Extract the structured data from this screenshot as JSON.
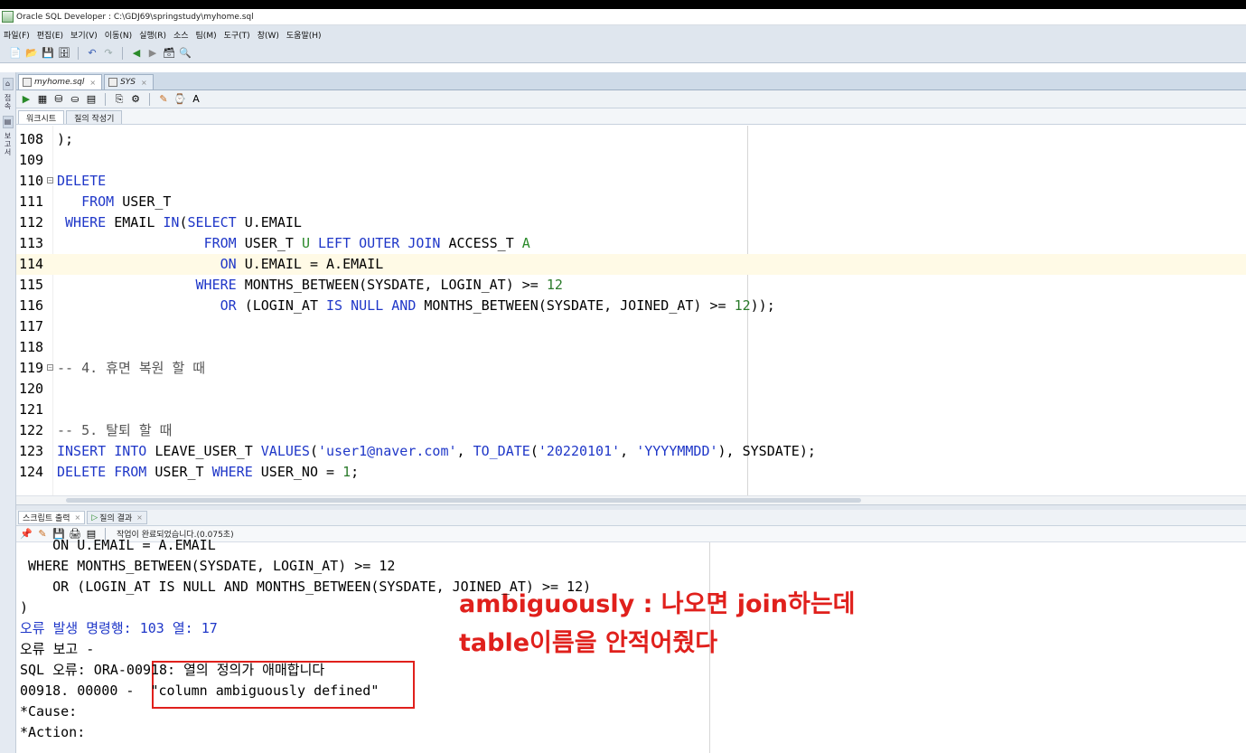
{
  "window": {
    "title": "Oracle SQL Developer : C:\\GDJ69\\springstudy\\myhome.sql"
  },
  "menu": [
    "파일(F)",
    "편집(E)",
    "보기(V)",
    "이동(N)",
    "실행(R)",
    "소스",
    "팀(M)",
    "도구(T)",
    "창(W)",
    "도움말(H)"
  ],
  "file_tabs": [
    {
      "label": "myhome.sql",
      "active": true
    },
    {
      "label": "SYS",
      "active": false
    }
  ],
  "sub_tabs": [
    {
      "label": "워크시트",
      "active": true
    },
    {
      "label": "질의 작성기",
      "active": false
    }
  ],
  "left_rail": {
    "label_top": "접속",
    "label_mid": "보고서"
  },
  "editor": {
    "current_line_index": 6,
    "lines": [
      {
        "num": "108",
        "html": ");"
      },
      {
        "num": "109",
        "html": ""
      },
      {
        "num": "110",
        "html": "<span class='kw'>DELETE</span>",
        "fold": true
      },
      {
        "num": "111",
        "html": "   <span class='kw'>FROM</span> USER_T"
      },
      {
        "num": "112",
        "html": " <span class='kw'>WHERE</span> EMAIL <span class='kw'>IN</span>(<span class='kw'>SELECT</span> U.EMAIL"
      },
      {
        "num": "113",
        "html": "                  <span class='kw'>FROM</span> USER_T <span class='alias'>U</span> <span class='kw'>LEFT OUTER JOIN</span> ACCESS_T <span class='alias'>A</span>"
      },
      {
        "num": "114",
        "html": "                    <span class='kw'>ON</span> U.EMAIL = A.EMAIL"
      },
      {
        "num": "115",
        "html": "                 <span class='kw'>WHERE</span> MONTHS_BETWEEN(SYSDATE, LOGIN_AT) &gt;= <span class='num'>12</span>"
      },
      {
        "num": "116",
        "html": "                    <span class='kw'>OR</span> (LOGIN_AT <span class='kw'>IS NULL AND</span> MONTHS_BETWEEN(SYSDATE, JOINED_AT) &gt;= <span class='num'>12</span>));"
      },
      {
        "num": "117",
        "html": ""
      },
      {
        "num": "118",
        "html": ""
      },
      {
        "num": "119",
        "html": "<span class='cmt'>-- 4. 휴면 복원 할 때</span>",
        "fold": true
      },
      {
        "num": "120",
        "html": ""
      },
      {
        "num": "121",
        "html": ""
      },
      {
        "num": "122",
        "html": "<span class='cmt'>-- 5. 탈퇴 할 때</span>"
      },
      {
        "num": "123",
        "html": "<span class='kw'>INSERT INTO</span> LEAVE_USER_T <span class='kw'>VALUES</span>(<span class='str'>'user1@naver.com'</span>, <span class='kw'>TO_DATE</span>(<span class='str'>'20220101'</span>, <span class='str'>'YYYYMMDD'</span>), SYSDATE);"
      },
      {
        "num": "124",
        "html": "<span class='kw'>DELETE FROM</span> USER_T <span class='kw'>WHERE</span> USER_NO = <span class='num'>1</span>;"
      }
    ]
  },
  "output_tabs": [
    {
      "label": "스크립트 출력",
      "active": true
    },
    {
      "label": "질의 결과",
      "active": false
    }
  ],
  "output_status": "작업이 완료되었습니다.(0.075초)",
  "output": {
    "lines": [
      {
        "text": "    ON U.EMAIL = A.EMAIL",
        "blue": false
      },
      {
        "text": " WHERE MONTHS_BETWEEN(SYSDATE, LOGIN_AT) >= 12",
        "blue": false
      },
      {
        "text": "    OR (LOGIN_AT IS NULL AND MONTHS_BETWEEN(SYSDATE, JOINED_AT) >= 12)",
        "blue": false
      },
      {
        "text": ")",
        "blue": false
      },
      {
        "text": "오류 발생 명령행: 103 열: 17",
        "blue": true
      },
      {
        "text": "오류 보고 -",
        "blue": false
      },
      {
        "text": "SQL 오류: ORA-00918: 열의 정의가 애매합니다",
        "blue": false
      },
      {
        "text": "00918. 00000 -  \"column ambiguously defined\"",
        "blue": false
      },
      {
        "text": "*Cause:",
        "blue": false
      },
      {
        "text": "*Action:",
        "blue": false
      }
    ]
  },
  "annotation": {
    "line1": "ambiguously : 나오면 join하는데",
    "line2": "table이름을 안적어줬다",
    "color": "#e0201c"
  }
}
